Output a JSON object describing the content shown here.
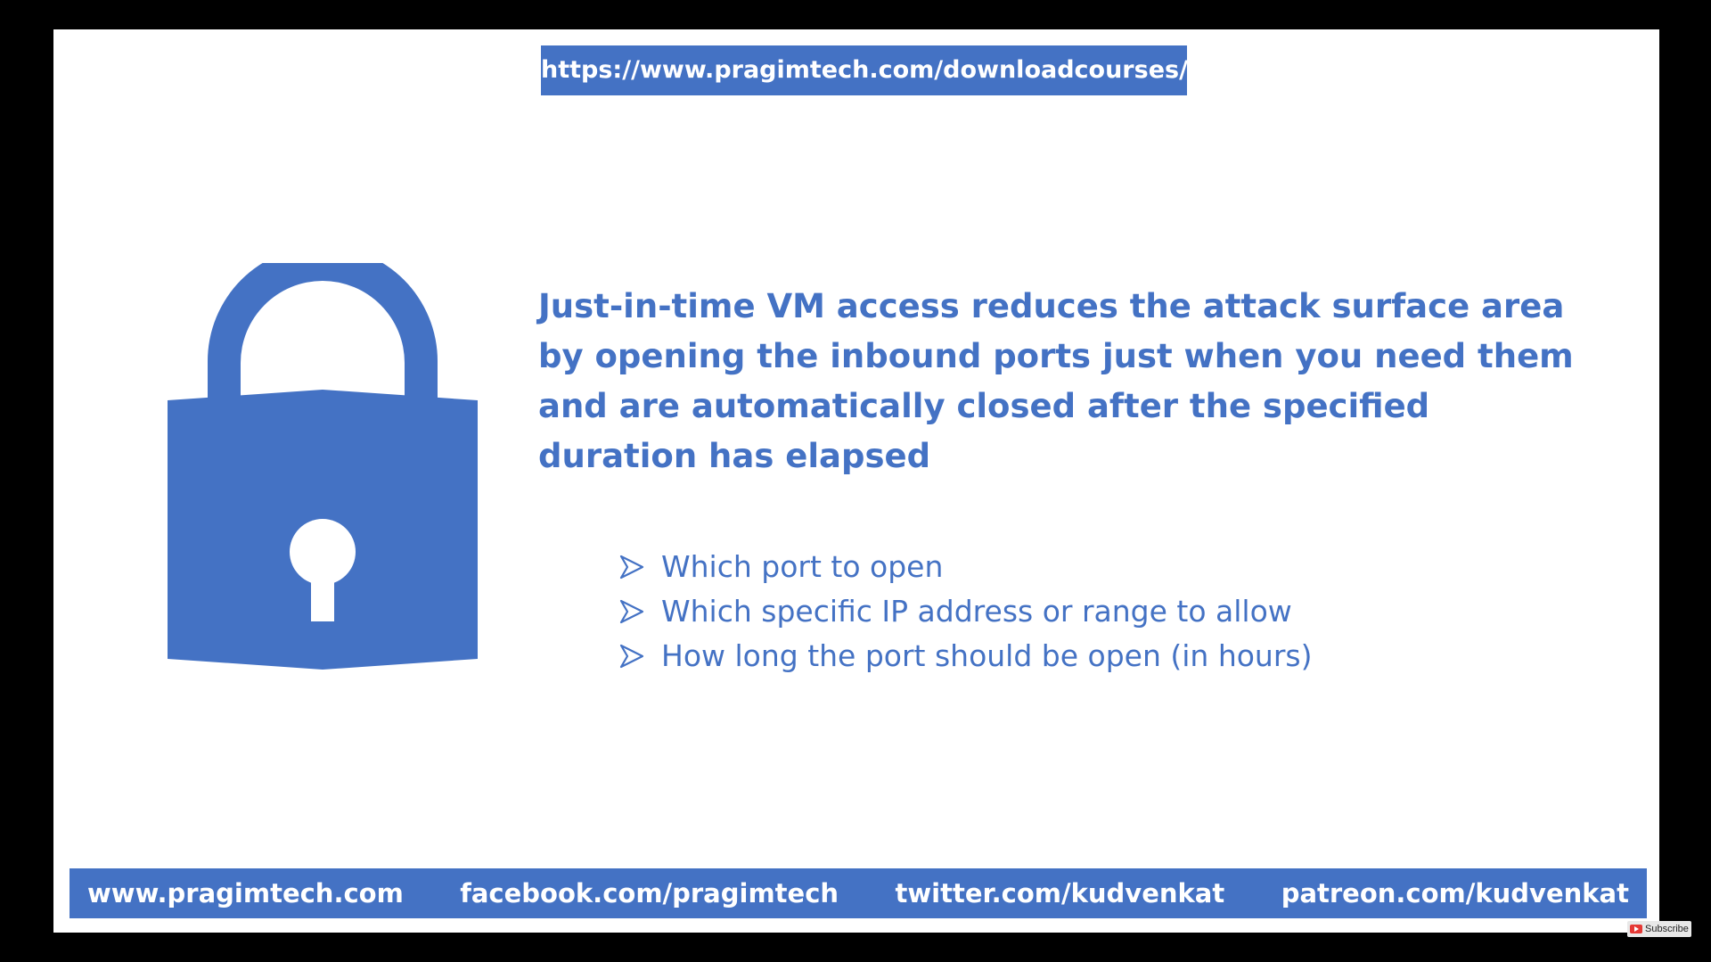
{
  "slide": {
    "url_banner": "https://www.pragimtech.com/downloadcourses/",
    "headline": "Just-in-time VM access reduces the attack surface area by opening the inbound ports just when you need them and are automatically closed after the specified duration has elapsed",
    "bullets": [
      "Which port to open",
      "Which specific IP address or range to allow",
      "How long the port should be open (in hours)"
    ],
    "bullet_icon": "arrow-icon",
    "illustration_icon": "padlock-icon"
  },
  "footer": {
    "links": [
      "www.pragimtech.com",
      "facebook.com/pragimtech",
      "twitter.com/kudvenkat",
      "patreon.com/kudvenkat"
    ]
  },
  "overlay": {
    "subscribe_label": "Subscribe"
  },
  "colors": {
    "accent": "#4472c4",
    "background": "#ffffff",
    "frame": "#000000"
  }
}
